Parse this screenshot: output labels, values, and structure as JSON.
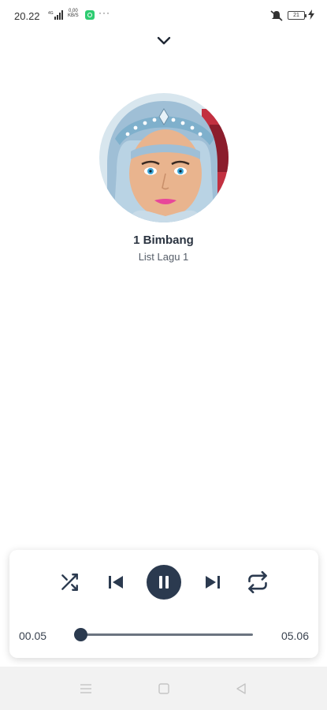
{
  "status_bar": {
    "time": "20.22",
    "speed_value": "0,00",
    "speed_unit": "KB/S",
    "network": "4G",
    "more": "···",
    "battery": "21"
  },
  "now_playing": {
    "title": "1 Bimbang",
    "subtitle": "List Lagu 1"
  },
  "player": {
    "elapsed": "00.05",
    "total": "05.06",
    "progress_fraction": 0.016
  },
  "colors": {
    "primary": "#2b3a4f",
    "track": "#6b7480"
  },
  "icons": {
    "collapse": "chevron-down-icon",
    "shuffle": "shuffle-icon",
    "previous": "skip-previous-icon",
    "pause": "pause-icon",
    "next": "skip-next-icon",
    "repeat": "repeat-icon"
  }
}
